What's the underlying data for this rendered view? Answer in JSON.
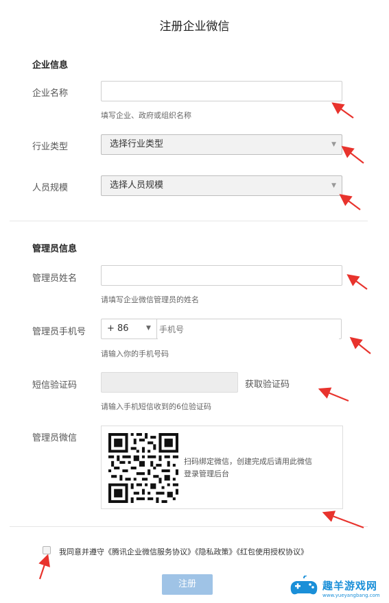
{
  "page_title": "注册企业微信",
  "company_section": {
    "title": "企业信息",
    "name_label": "企业名称",
    "name_value": "",
    "name_help": "填写企业、政府或组织名称",
    "industry_label": "行业类型",
    "industry_value": "选择行业类型",
    "scale_label": "人员规模",
    "scale_value": "选择人员规模"
  },
  "admin_section": {
    "title": "管理员信息",
    "name_label": "管理员姓名",
    "name_value": "",
    "name_help": "请填写企业微信管理员的姓名",
    "phone_label": "管理员手机号",
    "country_code": "+ 86",
    "phone_placeholder": "手机号",
    "phone_help": "请输入你的手机号码",
    "sms_label": "短信验证码",
    "sms_value": "",
    "sms_button": "获取验证码",
    "sms_help": "请输入手机短信收到的6位验证码",
    "wechat_label": "管理员微信",
    "qr_text_line1": "扫码绑定微信，创建完成后请用此微信",
    "qr_text_line2": "登录管理后台"
  },
  "agreement": {
    "prefix": "我同意并遵守",
    "link1": "《腾讯企业微信服务协议》",
    "link2": "《隐私政策》",
    "link3": "《红包使用授权协议》",
    "checked": false
  },
  "submit_label": "注册",
  "watermark": {
    "name": "趣羊游戏网",
    "url": "www.yueyangbang.com"
  },
  "colors": {
    "arrow": "#e8332d",
    "button": "#9fc3e6",
    "watermark": "#1a8fd8"
  }
}
